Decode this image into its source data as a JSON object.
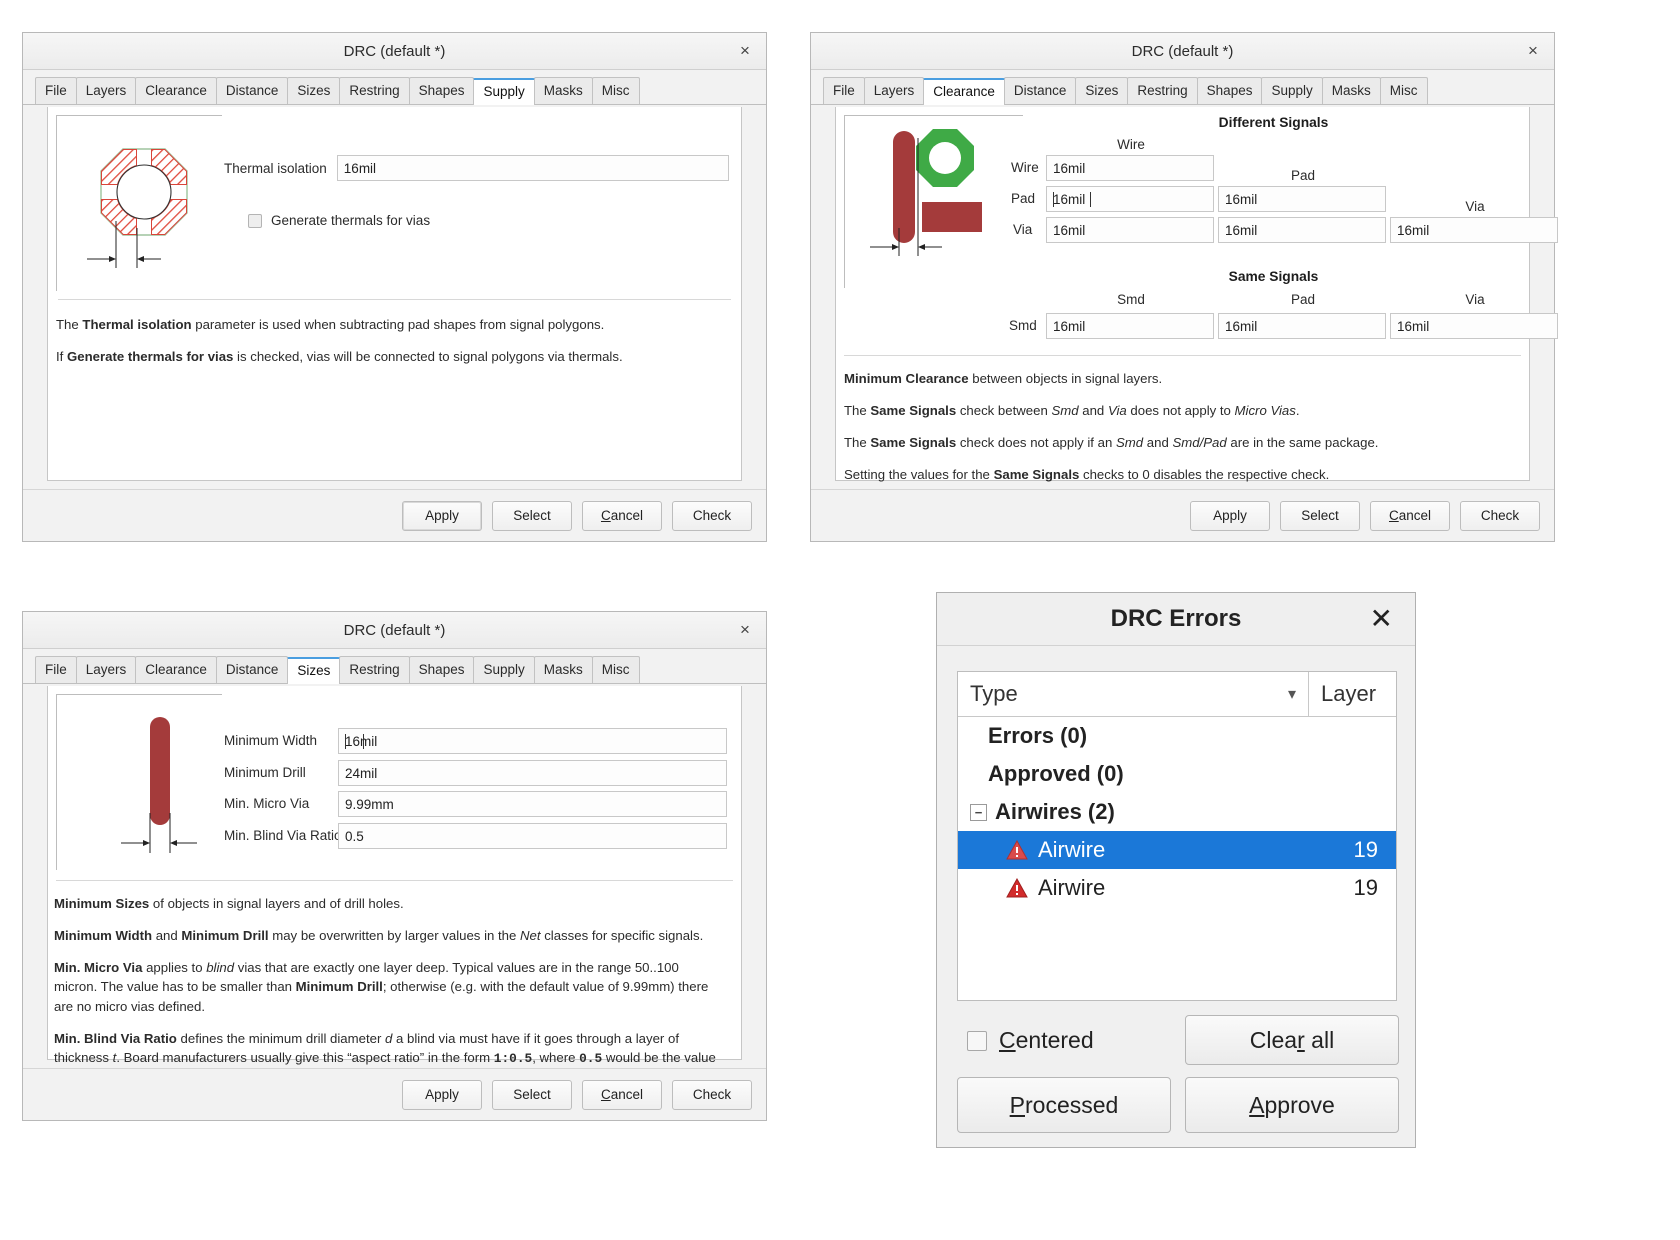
{
  "tabs": [
    "File",
    "Layers",
    "Clearance",
    "Distance",
    "Sizes",
    "Restring",
    "Shapes",
    "Supply",
    "Masks",
    "Misc"
  ],
  "buttons": {
    "apply": "Apply",
    "select": "Select",
    "cancel": "Cancel",
    "check": "Check"
  },
  "colors": {
    "accent": "#4a9ee0",
    "selection": "#1b78d8",
    "pad_red": "#a43b3b",
    "pad_green": "#3faa46",
    "hatch_red": "#e04a3c"
  },
  "supply_dialog": {
    "title": "DRC (default *)",
    "active_tab": "Supply",
    "close_label": "×",
    "thermal_isolation_label": "Thermal isolation",
    "thermal_isolation_value": "16mil",
    "generate_thermals_label": "Generate thermals for vias",
    "generate_thermals_checked": false,
    "description": [
      {
        "parts": [
          {
            "t": "The ",
            "s": "n"
          },
          {
            "t": "Thermal isolation",
            "s": "b"
          },
          {
            "t": " parameter is used when subtracting pad shapes from signal polygons.",
            "s": "n"
          }
        ]
      },
      {
        "parts": [
          {
            "t": "If ",
            "s": "n"
          },
          {
            "t": "Generate thermals for vias",
            "s": "b"
          },
          {
            "t": " is checked, vias will be connected to signal polygons via thermals.",
            "s": "n"
          }
        ]
      }
    ]
  },
  "clearance_dialog": {
    "title": "DRC (default *)",
    "active_tab": "Clearance",
    "close_label": "×",
    "different_signals_header": "Different Signals",
    "same_signals_header": "Same Signals",
    "different_col_headers": [
      "Wire",
      "Pad",
      "Via"
    ],
    "different_rows": [
      {
        "label": "Wire",
        "values": [
          "16mil"
        ]
      },
      {
        "label": "Pad",
        "values": [
          "16mil",
          "16mil"
        ]
      },
      {
        "label": "Via",
        "values": [
          "16mil",
          "16mil",
          "16mil"
        ]
      }
    ],
    "focused_cell": {
      "row": "Pad",
      "col": 0
    },
    "same_col_headers": [
      "Smd",
      "Pad",
      "Via"
    ],
    "same_rows": [
      {
        "label": "Smd",
        "values": [
          "16mil",
          "16mil",
          "16mil"
        ]
      }
    ],
    "description": [
      {
        "parts": [
          {
            "t": "Minimum Clearance",
            "s": "b"
          },
          {
            "t": " between objects in signal layers.",
            "s": "n"
          }
        ]
      },
      {
        "parts": [
          {
            "t": "The ",
            "s": "n"
          },
          {
            "t": "Same Signals",
            "s": "b"
          },
          {
            "t": " check between ",
            "s": "n"
          },
          {
            "t": "Smd",
            "s": "i"
          },
          {
            "t": " and ",
            "s": "n"
          },
          {
            "t": "Via",
            "s": "i"
          },
          {
            "t": " does not apply to ",
            "s": "n"
          },
          {
            "t": "Micro Vias",
            "s": "i"
          },
          {
            "t": ".",
            "s": "n"
          }
        ]
      },
      {
        "parts": [
          {
            "t": "The ",
            "s": "n"
          },
          {
            "t": "Same Signals",
            "s": "b"
          },
          {
            "t": " check does not apply if an ",
            "s": "n"
          },
          {
            "t": "Smd",
            "s": "i"
          },
          {
            "t": " and ",
            "s": "n"
          },
          {
            "t": "Smd/Pad",
            "s": "i"
          },
          {
            "t": " are in the same package.",
            "s": "n"
          }
        ]
      },
      {
        "parts": [
          {
            "t": "Setting the values for the ",
            "s": "n"
          },
          {
            "t": "Same Signals",
            "s": "b"
          },
          {
            "t": " checks to 0 disables the respective check.",
            "s": "n"
          }
        ]
      }
    ]
  },
  "sizes_dialog": {
    "title": "DRC (default *)",
    "active_tab": "Sizes",
    "close_label": "×",
    "fields": [
      {
        "label": "Minimum Width",
        "value": "16mil",
        "focused": true
      },
      {
        "label": "Minimum Drill",
        "value": "24mil",
        "focused": false
      },
      {
        "label": "Min. Micro Via",
        "value": "9.99mm",
        "focused": false
      },
      {
        "label": "Min. Blind Via Ratio",
        "value": "0.5",
        "focused": false
      }
    ],
    "description": [
      {
        "parts": [
          {
            "t": "Minimum Sizes",
            "s": "b"
          },
          {
            "t": " of objects in signal layers and of drill holes.",
            "s": "n"
          }
        ]
      },
      {
        "parts": [
          {
            "t": "Minimum Width",
            "s": "b"
          },
          {
            "t": " and ",
            "s": "n"
          },
          {
            "t": "Minimum Drill",
            "s": "b"
          },
          {
            "t": " may be overwritten by larger values in the ",
            "s": "n"
          },
          {
            "t": "Net",
            "s": "i"
          },
          {
            "t": " classes for specific signals.",
            "s": "n"
          }
        ]
      },
      {
        "parts": [
          {
            "t": "Min. Micro Via",
            "s": "b"
          },
          {
            "t": " applies to ",
            "s": "n"
          },
          {
            "t": "blind",
            "s": "i"
          },
          {
            "t": " vias that are exactly one layer deep. Typical values are in the range 50..100 micron. The value has to be smaller than ",
            "s": "n"
          },
          {
            "t": "Minimum Drill",
            "s": "b"
          },
          {
            "t": "; otherwise (e.g. with the default value of 9.99mm) there are no micro vias defined.",
            "s": "n"
          }
        ]
      },
      {
        "parts": [
          {
            "t": "Min. Blind Via Ratio",
            "s": "b"
          },
          {
            "t": " defines the minimum drill diameter ",
            "s": "n"
          },
          {
            "t": "d",
            "s": "i"
          },
          {
            "t": " a blind via must have if it goes through a layer of thickness ",
            "s": "n"
          },
          {
            "t": "t",
            "s": "i"
          },
          {
            "t": ". Board manufacturers usually give this “aspect ratio” in the form ",
            "s": "n"
          },
          {
            "t": "1:0.5",
            "s": "m"
          },
          {
            "t": ", where ",
            "s": "n"
          },
          {
            "t": "0.5",
            "s": "m"
          },
          {
            "t": " would be the value that has to be entered here.",
            "s": "n"
          }
        ]
      }
    ]
  },
  "drc_errors": {
    "title": "DRC Errors",
    "close_label": "✕",
    "columns": [
      "Type",
      "Layer"
    ],
    "rows": [
      {
        "label": "Errors (0)",
        "indent": 1,
        "group": true,
        "icon": "none",
        "expander": "none",
        "layer": "",
        "selected": false
      },
      {
        "label": "Approved (0)",
        "indent": 1,
        "group": true,
        "icon": "none",
        "expander": "none",
        "layer": "",
        "selected": false
      },
      {
        "label": "Airwires (2)",
        "indent": 0,
        "group": true,
        "icon": "none",
        "expander": "minus",
        "layer": "",
        "selected": false
      },
      {
        "label": "Airwire",
        "indent": 2,
        "group": false,
        "icon": "warning-light",
        "expander": "none",
        "layer": "19",
        "selected": true
      },
      {
        "label": "Airwire",
        "indent": 2,
        "group": false,
        "icon": "warning-red",
        "expander": "none",
        "layer": "19",
        "selected": false
      }
    ],
    "centered_label": "Centered",
    "centered_checked": false,
    "clear_all_label": "Clear all",
    "processed_label": "Processed",
    "approve_label": "Approve"
  }
}
